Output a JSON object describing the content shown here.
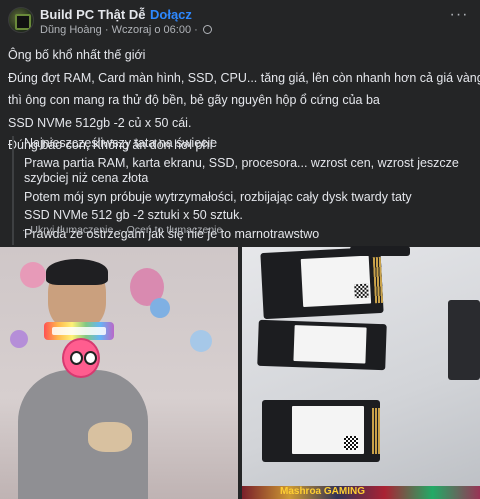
{
  "header": {
    "group_name": "Build PC Thật Dễ",
    "separator": "·",
    "join_label": "Dołącz",
    "author": "Dũng Hoàng",
    "time": "Wczoraj o 06:00",
    "more_label": "···"
  },
  "post": {
    "lines": [
      "Ông bố khổ nhất thế giới",
      "Đúng đợt RAM, Card màn hình, SSD, CPU... tăng giá, lên còn nhanh hơn cả giá vàng",
      "thì ông con mang ra thử độ bền, bẻ gãy nguyên hộp ổ cứng của ba",
      "SSD NVMe 512gb -2 củ x 50 cái.",
      "Đúng báo con, Không ăn đòn hơi phí"
    ]
  },
  "translation": {
    "lines": [
      "Najnieszczęśliwszy tata na świecie",
      "Prawa partia RAM, karta ekranu, SSD, procesora... wzrost cen, wzrost jeszcze szybciej niż cena złota",
      "Potem mój syn próbuje wytrzymałości, rozbijając cały dysk twardy taty",
      "SSD NVMe 512 gb -2 sztuki x 50 sztuk.",
      "Prawda że ostrzegam jak się nie je to marnotrawstwo"
    ],
    "hide_label": "Ukryj tłumaczenie",
    "rate_label": "Oceń to tłumaczenie"
  },
  "photos": {
    "right_banner_text": "Mashroa GAMING"
  }
}
